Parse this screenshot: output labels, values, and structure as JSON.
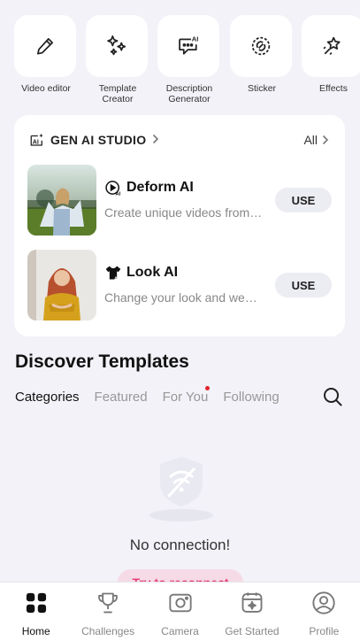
{
  "tools": [
    {
      "label": "Video editor",
      "icon": "pencil-icon"
    },
    {
      "label": "Template\nCreator",
      "icon": "sparkles-icon"
    },
    {
      "label": "Description\nGenerator",
      "icon": "ai-chat-icon"
    },
    {
      "label": "Sticker",
      "icon": "sticker-icon"
    },
    {
      "label": "Effects",
      "icon": "star-effects-icon"
    }
  ],
  "studio": {
    "title": "GEN AI STUDIO",
    "all_label": "All",
    "items": [
      {
        "name": "Deform AI",
        "desc": "Create unique videos from your photos",
        "button": "USE"
      },
      {
        "name": "Look AI",
        "desc": "Change your look and wear new outfits",
        "button": "USE"
      }
    ]
  },
  "discover": {
    "title": "Discover Templates",
    "tabs": [
      "Categories",
      "Featured",
      "For You",
      "Following"
    ]
  },
  "empty": {
    "message": "No connection!",
    "retry_label": "Try to reconnect"
  },
  "nav": [
    "Home",
    "Challenges",
    "Camera",
    "Get Started",
    "Profile"
  ],
  "colors": {
    "background": "#f2f2f8",
    "accent_pink": "#e3427a",
    "notification_dot": "#e0242d"
  }
}
